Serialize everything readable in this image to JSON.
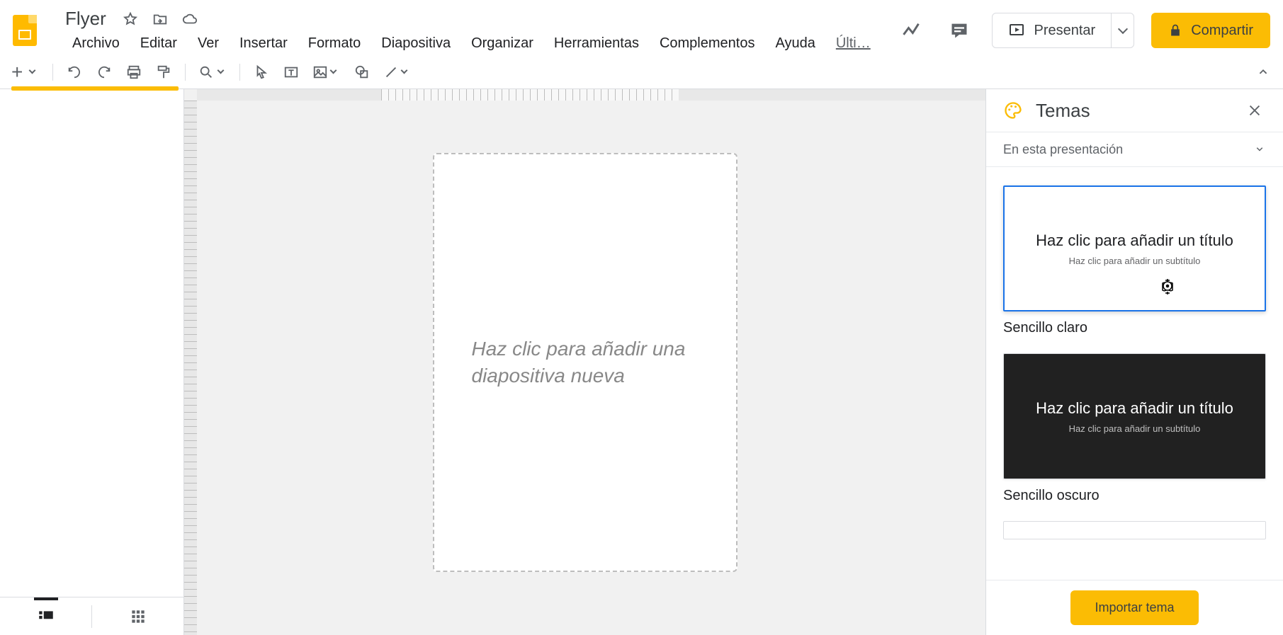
{
  "doc_title": "Flyer",
  "menu": [
    "Archivo",
    "Editar",
    "Ver",
    "Insertar",
    "Formato",
    "Diapositiva",
    "Organizar",
    "Herramientas",
    "Complementos",
    "Ayuda"
  ],
  "menu_last_edit": "Últi…",
  "present_label": "Presentar",
  "share_label": "Compartir",
  "slide_placeholder": "Haz clic para añadir una diapositiva nueva",
  "themes": {
    "panel_title": "Temas",
    "row_label": "En esta presentación",
    "card_title": "Haz clic para añadir un título",
    "card_subtitle": "Haz clic para añadir un subtítulo",
    "items": [
      {
        "label": "Sencillo claro"
      },
      {
        "label": "Sencillo oscuro"
      }
    ],
    "import_label": "Importar tema"
  }
}
